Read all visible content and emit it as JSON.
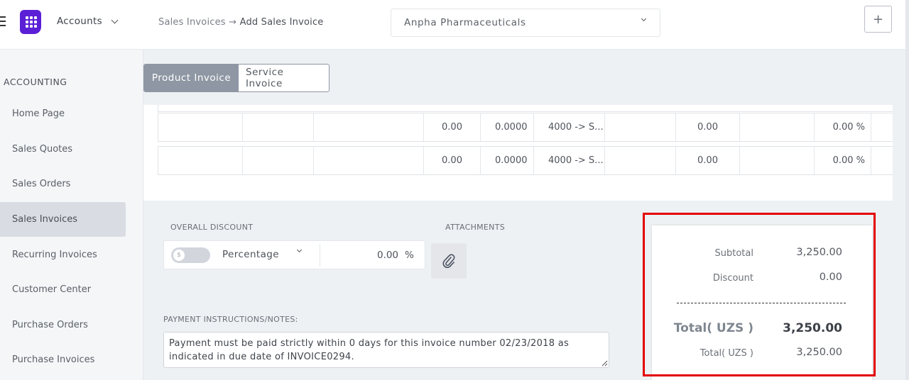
{
  "app": {
    "name": "Accounts"
  },
  "sidebar": {
    "section": "ACCOUNTING",
    "items": [
      {
        "label": "Home Page"
      },
      {
        "label": "Sales Quotes"
      },
      {
        "label": "Sales Orders"
      },
      {
        "label": "Sales Invoices"
      },
      {
        "label": "Recurring Invoices"
      },
      {
        "label": "Customer Center"
      },
      {
        "label": "Purchase Orders"
      },
      {
        "label": "Purchase Invoices"
      }
    ]
  },
  "header": {
    "breadcrumb_parent": "Sales Invoices",
    "breadcrumb_arrow": "→",
    "breadcrumb_current": "Add Sales Invoice",
    "company": "Anpha Pharmaceuticals",
    "plus_label": "+"
  },
  "tabs": [
    {
      "label": "Product Invoice"
    },
    {
      "label": "Service Invoice"
    }
  ],
  "rows": [
    {
      "amount": "0.00",
      "rate": "0.0000",
      "account": "4000 -> S...",
      "tax": "0.00",
      "pct": "0.00 %"
    },
    {
      "amount": "0.00",
      "rate": "0.0000",
      "account": "4000 -> S...",
      "tax": "0.00",
      "pct": "0.00 %"
    }
  ],
  "discount": {
    "label": "OVERALL DISCOUNT",
    "type": "Percentage",
    "value": "0.00",
    "unit": "%"
  },
  "attachments": {
    "label": "ATTACHMENTS"
  },
  "notes": {
    "label": "PAYMENT INSTRUCTIONS/NOTES:",
    "text": "Payment must be paid strictly within 0 days for this invoice number 02/23/2018 as indicated in due date of INVOICE0294."
  },
  "totals": {
    "subtotal_label": "Subtotal",
    "subtotal": "3,250.00",
    "discount_label": "Discount",
    "discount": "0.00",
    "total_label": "Total( UZS )",
    "total": "3,250.00",
    "total2_label": "Total( UZS )",
    "total2": "3,250.00"
  },
  "colors": {
    "accent": "#5b1fd6",
    "highlight": "#e30000",
    "tab_active": "#8e97a3"
  }
}
